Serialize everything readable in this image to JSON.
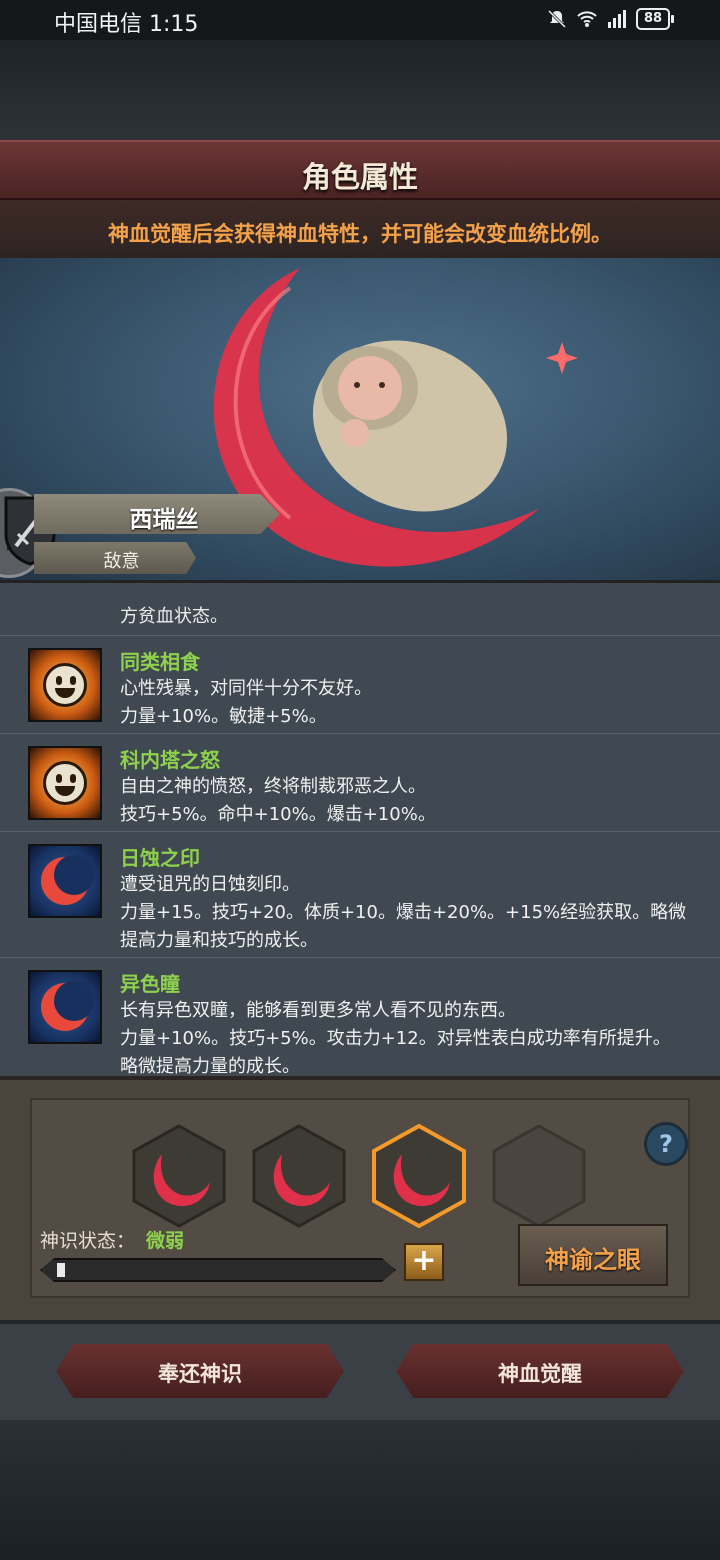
{
  "status_bar": {
    "carrier_time": "中国电信 1:15",
    "battery": "88",
    "network": "4G"
  },
  "header": {
    "title": "角色属性"
  },
  "notice": "神血觉醒后会获得神血特性，并可能会改变血统比例。",
  "character": {
    "name": "西瑞丝",
    "tag": "敌意"
  },
  "traits_partial_line": "方贫血状态。",
  "traits": [
    {
      "name": "同类相食",
      "icon": "smile-icon",
      "desc": [
        "心性残暴，对同伴十分不友好。",
        "力量+10%。敏捷+5%。"
      ]
    },
    {
      "name": "科内塔之怒",
      "icon": "smile-icon",
      "desc": [
        "自由之神的愤怒，终将制裁邪恶之人。",
        "技巧+5%。命中+10%。爆击+10%。"
      ]
    },
    {
      "name": "日蚀之印",
      "icon": "crescent-moon-icon",
      "desc": [
        "遭受诅咒的日蚀刻印。",
        "力量+15。技巧+20。体质+10。爆击+20%。+15%经验获取。略微",
        "提高力量和技巧的成长。"
      ]
    },
    {
      "name": "异色瞳",
      "icon": "crescent-moon-icon",
      "desc": [
        "长有异色双瞳，能够看到更多常人看不见的东西。",
        "力量+10%。技巧+5%。攻击力+12。对异性表白成功率有所提升。",
        "略微提高力量的成长。"
      ]
    }
  ],
  "divine": {
    "help": "?",
    "state_label": "神识状态：",
    "state_value": "微弱",
    "progress": 0.02,
    "plus": "+",
    "oracle_button": "神谕之眼"
  },
  "buttons": {
    "return": "奉还神识",
    "awaken": "神血觉醒"
  },
  "colors": {
    "accent_orange": "#f3a14b",
    "trait_green": "#8ed14c",
    "header_red": "#5a2b2b"
  }
}
